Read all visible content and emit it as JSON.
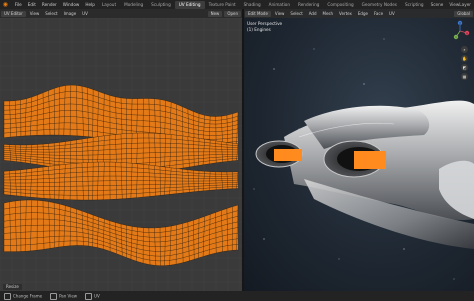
{
  "menu": [
    "File",
    "Edit",
    "Render",
    "Window",
    "Help"
  ],
  "workspaces": [
    "Layout",
    "Modeling",
    "Sculpting",
    "UV Editing",
    "Texture Paint",
    "Shading",
    "Animation",
    "Rendering",
    "Compositing",
    "Geometry Nodes",
    "Scripting"
  ],
  "active_workspace": "UV Editing",
  "topbar_right": [
    "Scene",
    "ViewLayer"
  ],
  "uv_header": {
    "mode": "UV Editor",
    "items": [
      "View",
      "Select",
      "Image",
      "UV"
    ],
    "right_items": [
      "New",
      "Open"
    ]
  },
  "viewport_header": {
    "mode": "Edit Mode",
    "items": [
      "View",
      "Select",
      "Add",
      "Mesh",
      "Vertex",
      "Edge",
      "Face",
      "UV"
    ],
    "right_items": [
      "Global"
    ]
  },
  "viewport_info": {
    "line1": "User Perspective",
    "line2": "(1) Engines"
  },
  "gizmo_axes": [
    "X",
    "Y",
    "Z"
  ],
  "redo_panel_label": "Resize",
  "statusbar": [
    "Change Frame",
    "Pan View",
    "UV"
  ],
  "colors": {
    "uv_island": "#e37a17",
    "uv_edge": "#1b1410",
    "uv_bg": "#3a3a3a",
    "grid": "#454545",
    "selected_face": "#ff8a1d"
  }
}
